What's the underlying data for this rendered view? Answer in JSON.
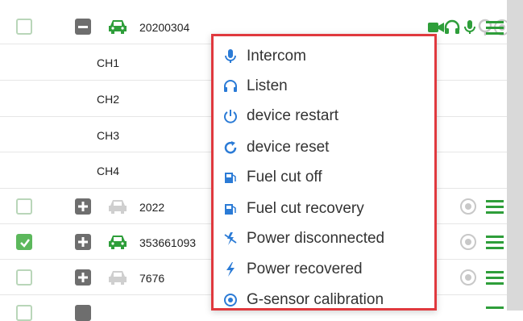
{
  "devices": [
    {
      "id": "20200304",
      "checked": false,
      "expanded": true,
      "online": true
    },
    {
      "id": "2022",
      "checked": false,
      "expanded": false,
      "online": false
    },
    {
      "id": "353661093",
      "checked": true,
      "expanded": false,
      "online": true
    },
    {
      "id": "7676",
      "checked": false,
      "expanded": false,
      "online": false
    }
  ],
  "channels": [
    "CH1",
    "CH2",
    "CH3",
    "CH4"
  ],
  "context_menu": {
    "items": [
      {
        "label": "Intercom",
        "icon": "microphone-icon"
      },
      {
        "label": "Listen",
        "icon": "headphones-icon"
      },
      {
        "label": "device restart",
        "icon": "power-icon"
      },
      {
        "label": "device reset",
        "icon": "refresh-icon"
      },
      {
        "label": "Fuel cut off",
        "icon": "fuel-icon"
      },
      {
        "label": "Fuel cut recovery",
        "icon": "fuel-recovery-icon"
      },
      {
        "label": "Power disconnected",
        "icon": "power-disconnected-icon"
      },
      {
        "label": "Power recovered",
        "icon": "lightning-icon"
      },
      {
        "label": "G-sensor calibration",
        "icon": "sensor-icon"
      }
    ]
  },
  "colors": {
    "green": "#2e9e3a",
    "icon_blue": "#2b7bd6",
    "menu_border": "#e0393e",
    "disabled": "#c8c8c8"
  }
}
